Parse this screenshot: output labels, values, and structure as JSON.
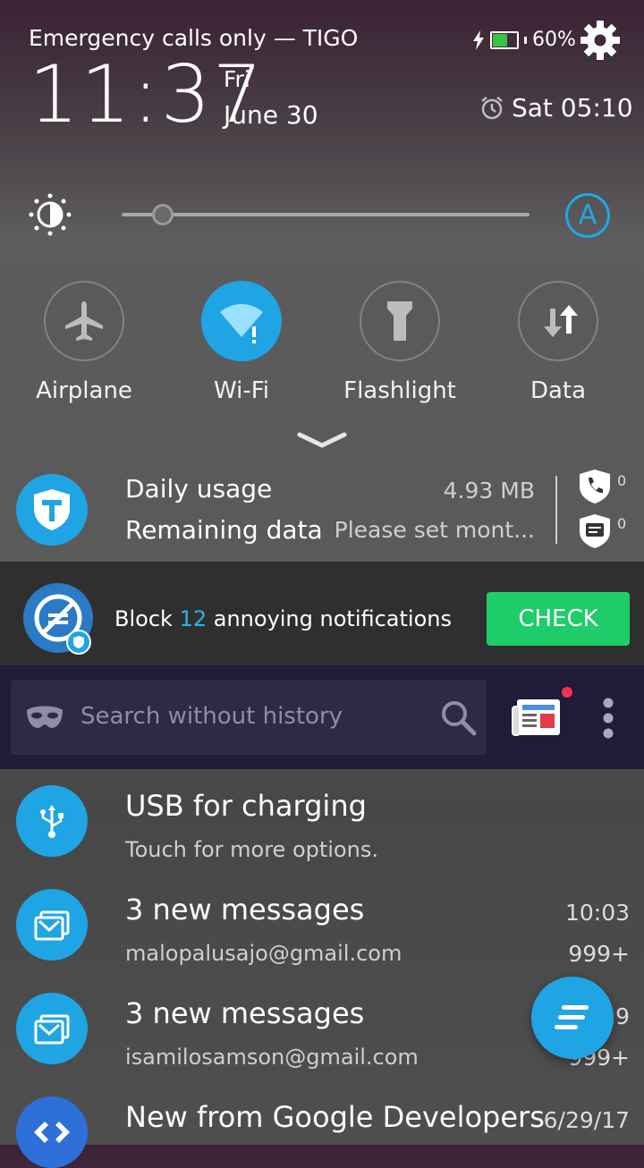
{
  "status": {
    "carrier": "Emergency calls only — TIGO",
    "battery_percent": "60%",
    "battery_level": 0.6,
    "time": "11:37",
    "day": "Fri",
    "date": "June 30",
    "alarm": "Sat 05:10"
  },
  "brightness": {
    "level": 0.1,
    "auto_label": "A"
  },
  "toggles": [
    {
      "label": "Airplane",
      "icon": "airplane-icon",
      "active": false
    },
    {
      "label": "Wi-Fi",
      "icon": "wifi-icon",
      "active": true
    },
    {
      "label": "Flashlight",
      "icon": "flashlight-icon",
      "active": false
    },
    {
      "label": "Data",
      "icon": "data-transfer-icon",
      "active": false
    }
  ],
  "usage": {
    "title": "Daily usage",
    "value": "4.93 MB",
    "subtitle": "Remaining data",
    "hint": "Please set mont...",
    "calls_blocked": "0",
    "messages_blocked": "0"
  },
  "block": {
    "prefix": "Block",
    "count": "12",
    "suffix": "annoying notifications",
    "button": "CHECK"
  },
  "search": {
    "placeholder": "Search without history"
  },
  "notifications": [
    {
      "title": "USB for charging",
      "subtitle": "Touch for more options.",
      "time": "",
      "count": "",
      "icon": "usb-icon"
    },
    {
      "title": "3 new messages",
      "subtitle": "malopalusajo@gmail.com",
      "time": "10:03",
      "count": "999+",
      "icon": "mail-icon"
    },
    {
      "title": "3 new messages",
      "subtitle": "isamilosamson@gmail.com",
      "time": "10:29",
      "count": "999+",
      "icon": "mail-icon"
    },
    {
      "title": "New from Google Developers",
      "subtitle": "",
      "time": "6/29/17",
      "count": "",
      "icon": "google-developers-icon"
    }
  ],
  "colors": {
    "accent": "#1fa5e3",
    "check_green": "#1fcc6a",
    "search_bar": "#1f1b38"
  }
}
